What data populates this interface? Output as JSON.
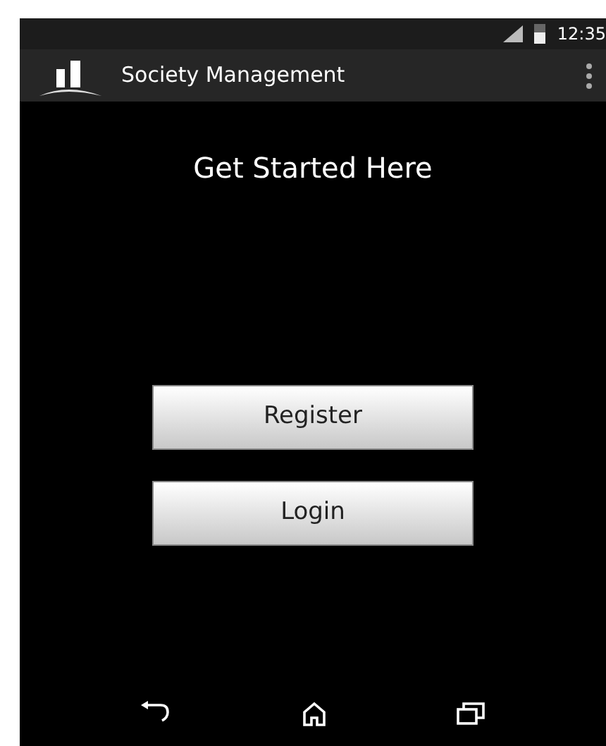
{
  "status_bar": {
    "time": "12:35"
  },
  "action_bar": {
    "title": "Society Management"
  },
  "heading": "Get Started Here",
  "buttons": [
    "Register",
    "Login"
  ]
}
